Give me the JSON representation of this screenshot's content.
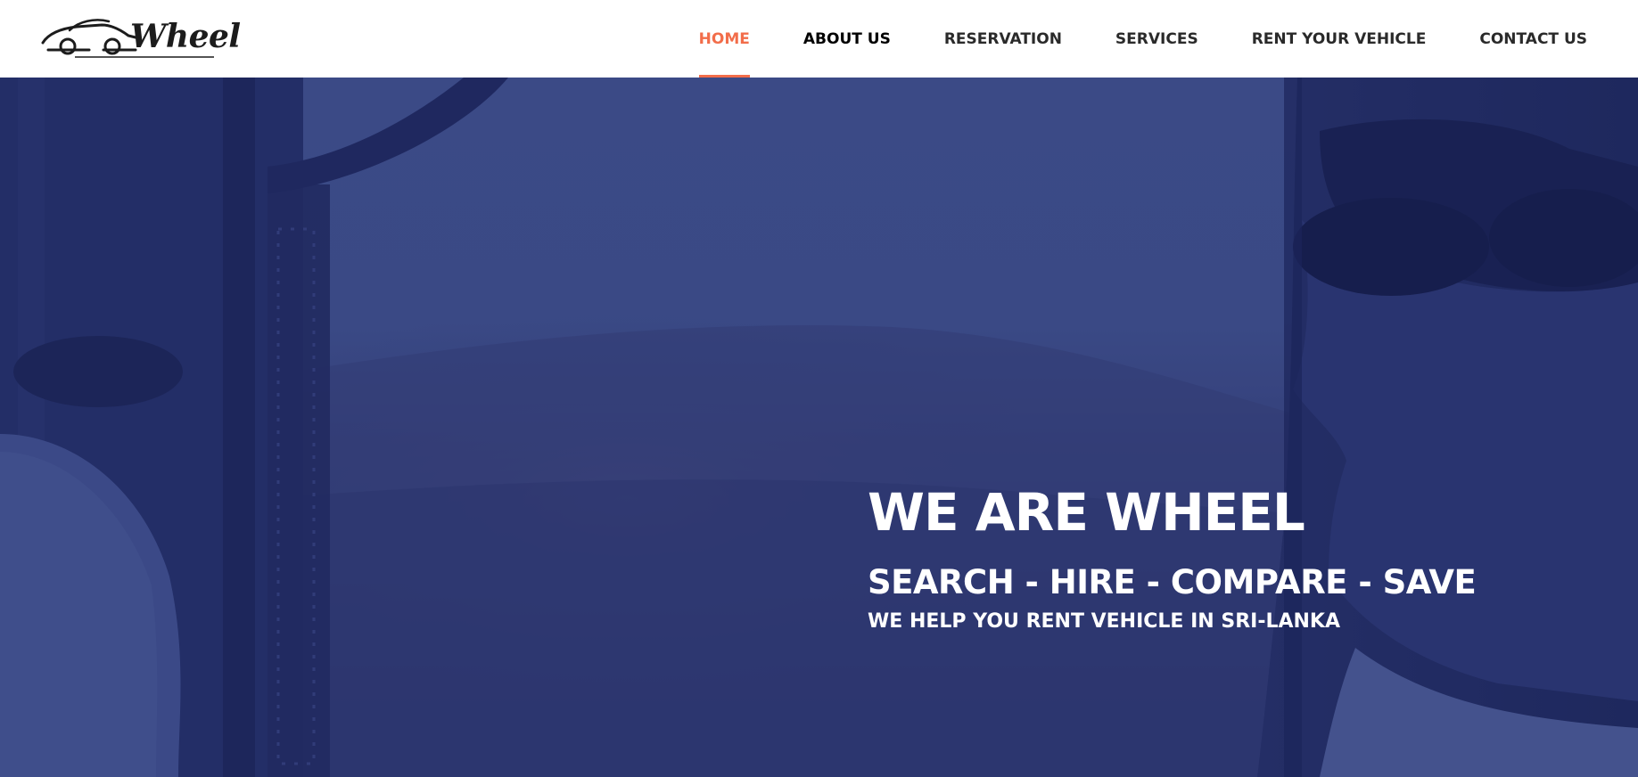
{
  "brand": {
    "name": "Wheel",
    "icon": "car-outline-icon"
  },
  "nav": {
    "items": [
      {
        "label": "HOME",
        "state": "active"
      },
      {
        "label": "ABOUT US",
        "state": "hover"
      },
      {
        "label": "RESERVATION",
        "state": "normal"
      },
      {
        "label": "SERVICES",
        "state": "normal"
      },
      {
        "label": "RENT YOUR VEHICLE",
        "state": "normal"
      },
      {
        "label": "CONTACT US",
        "state": "normal"
      }
    ]
  },
  "hero": {
    "title": "WE ARE WHEEL",
    "subtitle": "SEARCH - HIRE - COMPARE - SAVE",
    "tagline": "WE HELP YOU RENT VEHICLE IN SRI-LANKA",
    "image": "man-driving-vehicle-photo"
  },
  "colors": {
    "accent": "#f26d4a",
    "nav_text": "#2a2a2a",
    "hero_overlay": "#2b3a7a",
    "hero_text": "#ffffff"
  }
}
